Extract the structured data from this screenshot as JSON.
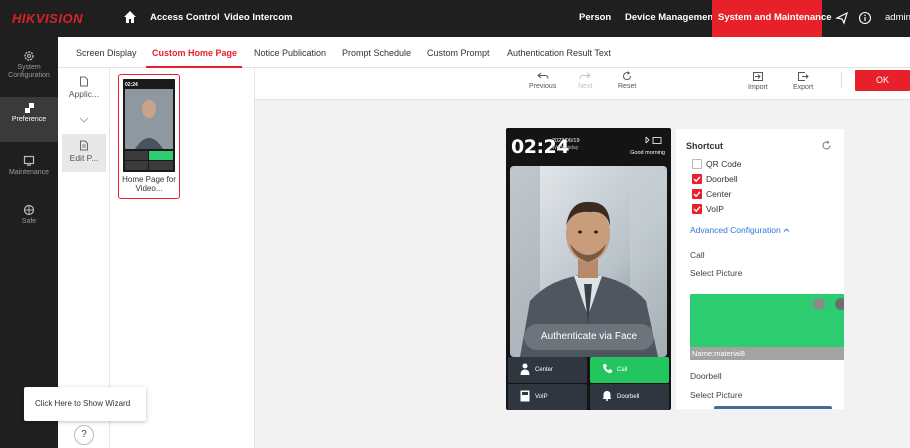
{
  "brand": {
    "logo": "HIKVISION",
    "accent": "#e8202a"
  },
  "topnav": {
    "access_control": "Access Control",
    "video_intercom": "Video Intercom",
    "person": "Person",
    "device_management": "Device Management",
    "system_maintenance": "System and Maintenance",
    "user": "admin"
  },
  "sidebar": {
    "items": [
      {
        "label": "System Configuration",
        "icon": "gear-icon"
      },
      {
        "label": "Preference",
        "icon": "brush-icon"
      },
      {
        "label": "Maintenance",
        "icon": "monitor-icon"
      },
      {
        "label": "Safe",
        "icon": "shield-icon"
      }
    ]
  },
  "tabs": [
    {
      "label": "Screen Display"
    },
    {
      "label": "Custom Home Page",
      "active": true
    },
    {
      "label": "Notice Publication"
    },
    {
      "label": "Prompt Schedule"
    },
    {
      "label": "Custom Prompt"
    },
    {
      "label": "Authentication Result Text"
    }
  ],
  "apps": [
    {
      "label": "Applic..."
    },
    {
      "label": "Edit P..."
    }
  ],
  "thumbnail": {
    "label": "Home Page for Video..."
  },
  "toolbar": {
    "previous": "Previous",
    "next": "Next",
    "reset": "Reset",
    "import": "Import",
    "export": "Export",
    "ok": "OK"
  },
  "device": {
    "time": "02:24",
    "date": "2022/06/19",
    "weekday": "Wednesday",
    "greeting": "Good morning",
    "auth_text": "Authenticate via Face",
    "buttons": {
      "center": "Center",
      "call": "Call",
      "voip": "VoIP",
      "doorbell": "Doorbell"
    }
  },
  "panel": {
    "title": "Shortcut",
    "checkboxes": [
      {
        "label": "QR Code",
        "checked": false
      },
      {
        "label": "Doorbell",
        "checked": true
      },
      {
        "label": "Center",
        "checked": true
      },
      {
        "label": "VoIP",
        "checked": true
      }
    ],
    "advanced": "Advanced Configuration",
    "call_label": "Call",
    "select_picture": "Select Picture",
    "material_name": "Name:material8",
    "doorbell_label": "Doorbell",
    "select_picture_2": "Select Picture"
  },
  "wizard": {
    "text": "Click Here to Show Wizard",
    "help": "?"
  }
}
